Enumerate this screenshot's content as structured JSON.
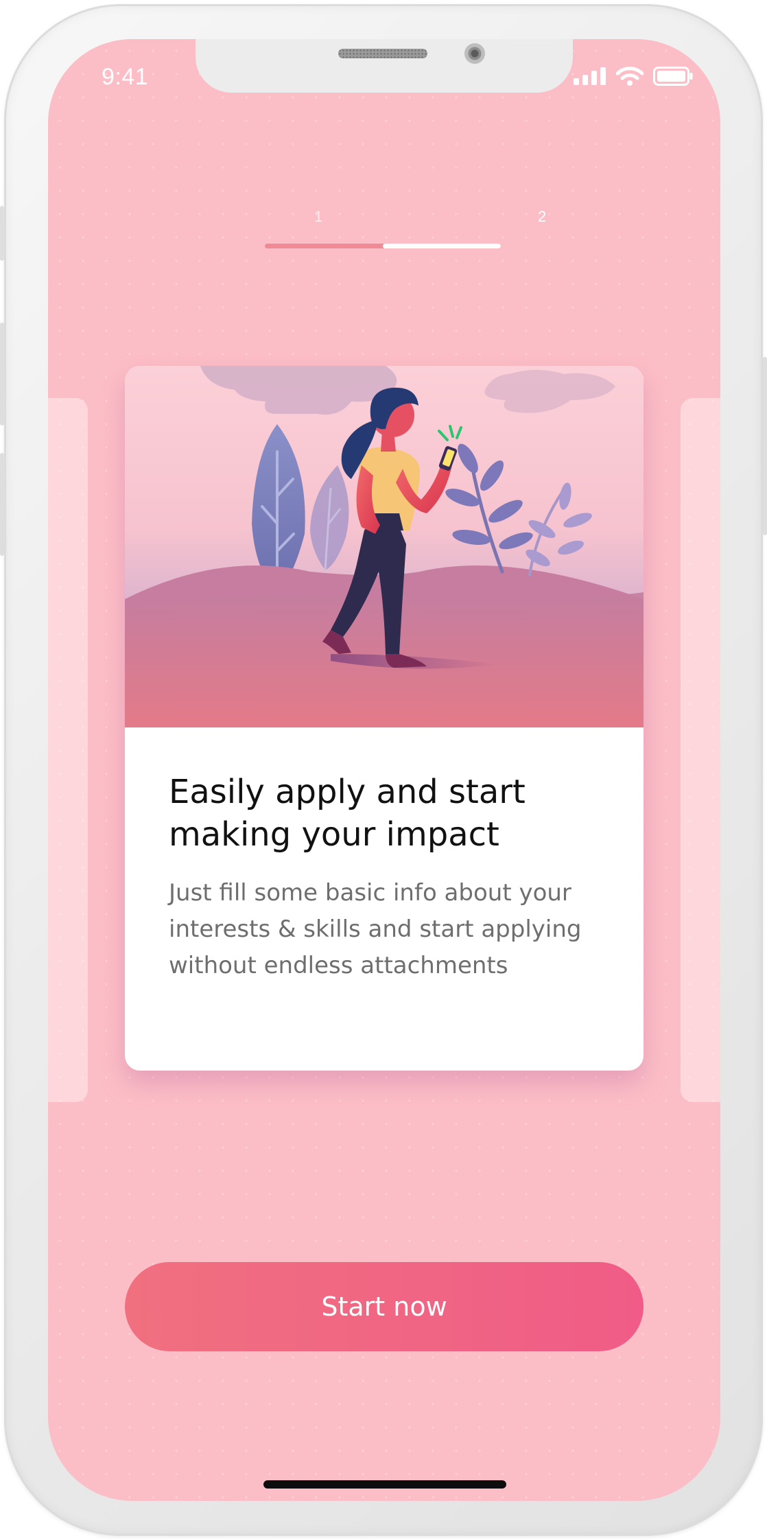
{
  "status_bar": {
    "time": "9:41"
  },
  "onboarding": {
    "steps": [
      "1",
      "2"
    ],
    "current_step": 2,
    "progress": 0.5
  },
  "card": {
    "title_line1": "Easily apply and start",
    "title_line2": "making your impact",
    "description": "Just fill some basic info about your interests & skills and start applying without endless attachments"
  },
  "cta": {
    "label": "Start now"
  },
  "colors": {
    "background": "#fcbec6",
    "accent_start": "#f0707f",
    "accent_end": "#f05c87",
    "progress_track": "#f08b96",
    "card": "#ffffff"
  }
}
